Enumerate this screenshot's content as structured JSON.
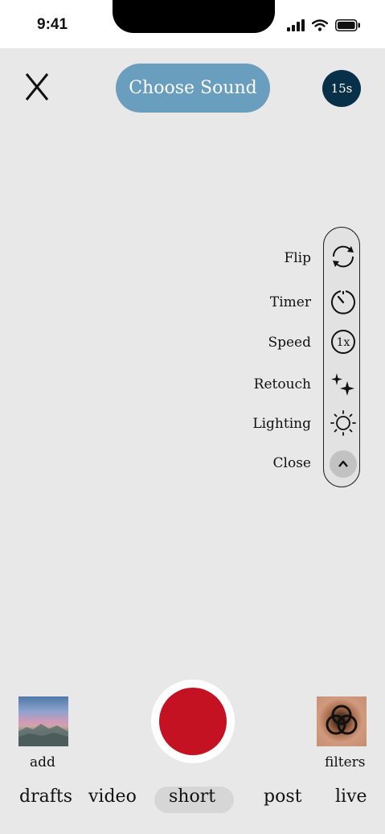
{
  "status_bar": {
    "time": "9:41"
  },
  "top_bar": {
    "choose_sound_label": "Choose Sound",
    "duration_label": "15s"
  },
  "tools": {
    "flip_label": "Flip",
    "timer_label": "Timer",
    "speed_label": "Speed",
    "speed_icon_text": "1x",
    "retouch_label": "Retouch",
    "lighting_label": "Lighting",
    "close_label": "Close"
  },
  "bottom": {
    "add_label": "add",
    "filters_label": "filters",
    "modes": [
      "drafts",
      "video",
      "short",
      "post",
      "live"
    ],
    "active_mode": "short"
  },
  "colors": {
    "background": "#e8e8e8",
    "choose_sound_bg": "#6a9ebf",
    "duration_bg": "#083049",
    "record_button": "#c41223",
    "active_mode_bg": "#d6d6d6"
  }
}
